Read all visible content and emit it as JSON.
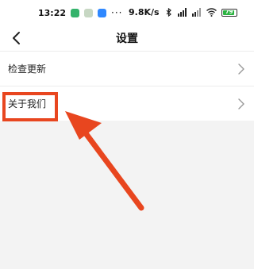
{
  "status_bar": {
    "time": "13:22",
    "notif_icons": [
      "app-green-icon",
      "app-gray-icon",
      "app-blue-icon"
    ],
    "more": "···",
    "network_speed": "9.8K/s",
    "battery_level": "79"
  },
  "header": {
    "title": "设置"
  },
  "settings": {
    "items": [
      {
        "label": "检查更新"
      },
      {
        "label": "关于我们"
      }
    ]
  },
  "colors": {
    "highlight": "#e8461f",
    "background": "#f3f3f3"
  }
}
